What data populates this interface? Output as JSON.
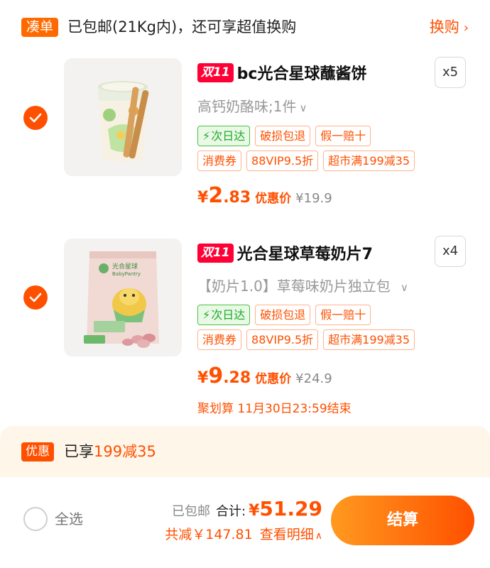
{
  "promo": {
    "tag": "凑单",
    "text": "已包邮(21Kg内)，还可享超值换购",
    "link": "换购",
    "link_icon": "chevron-right-icon"
  },
  "items": [
    {
      "checked": true,
      "badge": "双11",
      "title": "bc光合星球蘸酱饼",
      "qty": "x5",
      "sku": "高钙奶酪味;1件",
      "tags": [
        "次日达",
        "破损包退",
        "假一赔十",
        "消费券",
        "88VIP9.5折",
        "超市满199减35"
      ],
      "price_currency": "¥",
      "price_int": "2",
      "price_dec": ".83",
      "price_label": "优惠价",
      "original_price": "¥19.9"
    },
    {
      "checked": true,
      "badge": "双11",
      "title": "光合星球草莓奶片7",
      "qty": "x4",
      "sku": "【奶片1.0】草莓味奶片独立包",
      "tags": [
        "次日达",
        "破损包退",
        "假一赔十",
        "消费券",
        "88VIP9.5折",
        "超市满199减35"
      ],
      "price_currency": "¥",
      "price_int": "9",
      "price_dec": ".28",
      "price_label": "优惠价",
      "original_price": "¥24.9",
      "deadline": "聚划算 11月30日23:59结束",
      "package_brand": "光合星球",
      "package_brand_en": "BabyPantry"
    }
  ],
  "discount": {
    "tag": "优惠",
    "text_prefix": "已享",
    "text_highlight": "199减35"
  },
  "footer": {
    "select_all": "全选",
    "select_all_checked": false,
    "shipping": "已包邮",
    "total_label": "合计:",
    "currency": "¥",
    "total": "51.29",
    "saved": "共减￥147.81",
    "detail": "查看明细",
    "checkout": "结算"
  },
  "colors": {
    "accent": "#ff5000",
    "badge_red": "#ff0036",
    "green": "#1faa2a",
    "discount_bg": "#fff6ea"
  }
}
